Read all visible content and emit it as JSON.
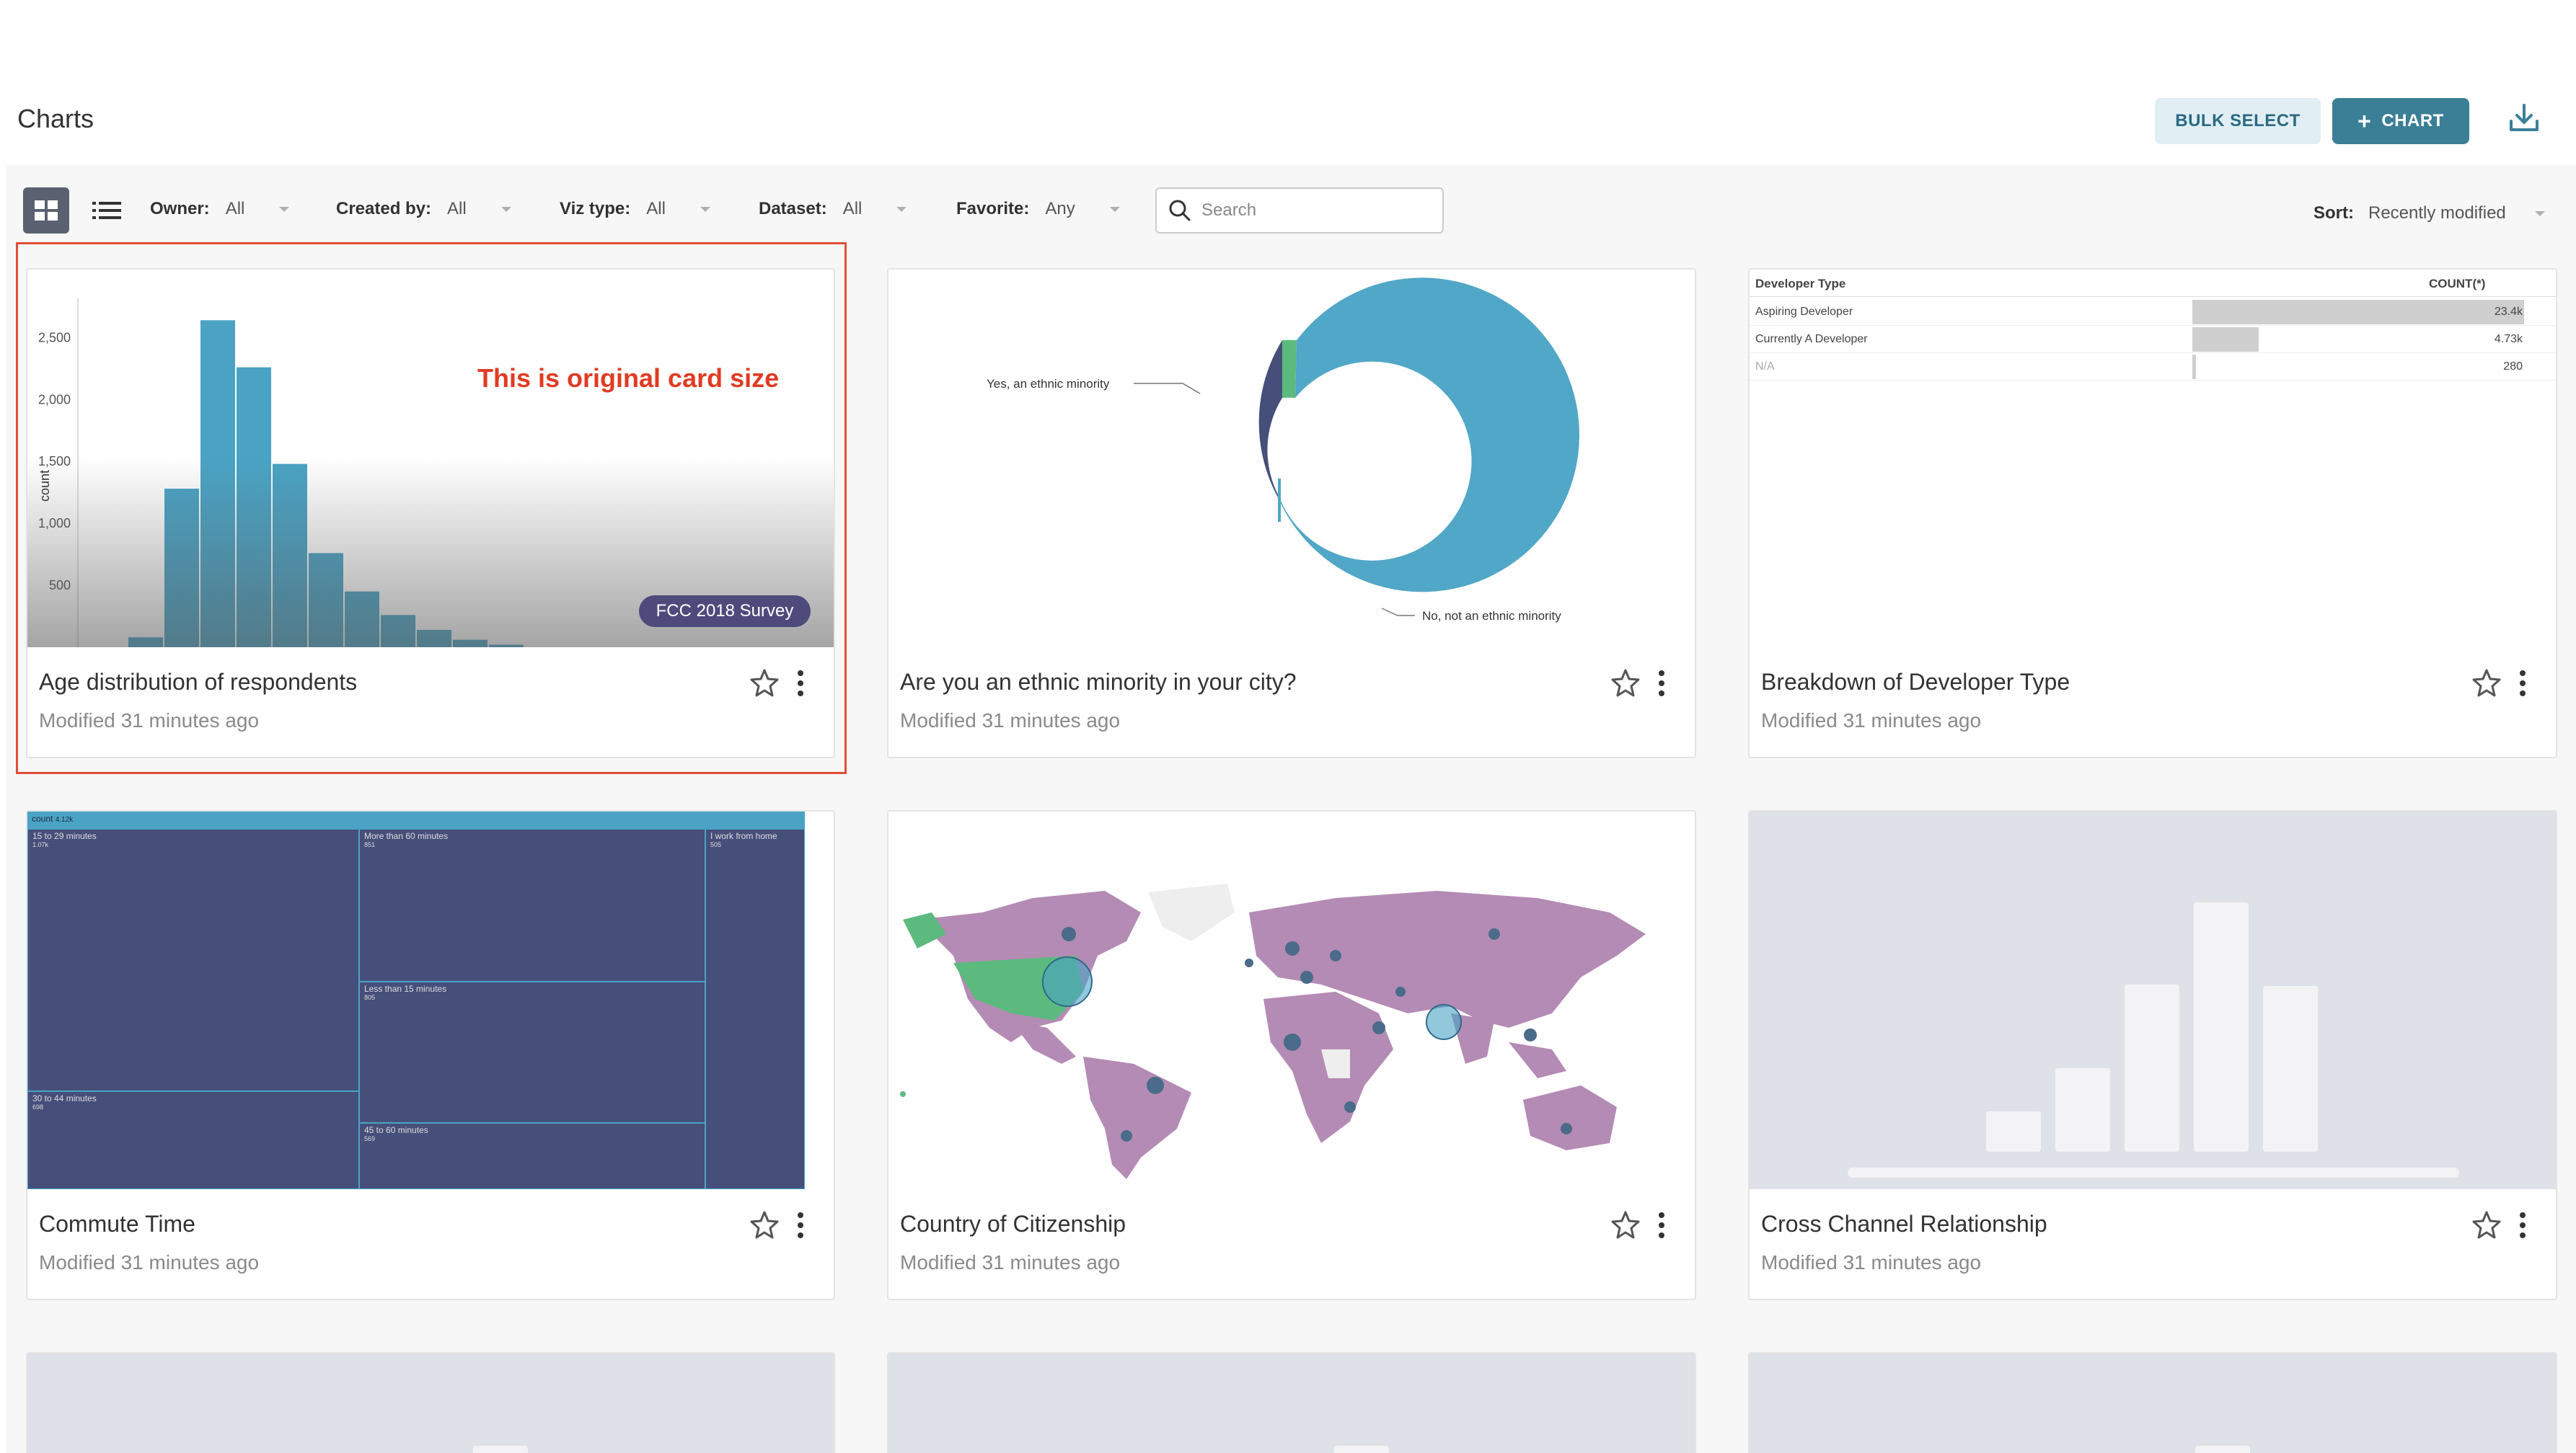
{
  "header": {
    "title": "Charts",
    "bulk_select": "BULK SELECT",
    "chart_button": "CHART",
    "chart_plus": "+"
  },
  "filters": {
    "owner": {
      "label": "Owner:",
      "value": "All"
    },
    "created_by": {
      "label": "Created by:",
      "value": "All"
    },
    "viz_type": {
      "label": "Viz type:",
      "value": "All"
    },
    "dataset": {
      "label": "Dataset:",
      "value": "All"
    },
    "favorite": {
      "label": "Favorite:",
      "value": "Any"
    },
    "search_placeholder": "Search",
    "sort": {
      "label": "Sort:",
      "value": "Recently modified"
    }
  },
  "annotation": "This is original card size",
  "cards": [
    {
      "title": "Age distribution of respondents",
      "modified": "Modified 31 minutes ago",
      "badge": "FCC 2018 Survey"
    },
    {
      "title": "Are you an ethnic minority in your city?",
      "modified": "Modified 31 minutes ago"
    },
    {
      "title": "Breakdown of Developer Type",
      "modified": "Modified 31 minutes ago"
    },
    {
      "title": "Commute Time",
      "modified": "Modified 31 minutes ago"
    },
    {
      "title": "Country of Citizenship",
      "modified": "Modified 31 minutes ago"
    },
    {
      "title": "Cross Channel Relationship",
      "modified": "Modified 31 minutes ago"
    }
  ],
  "histogram": {
    "ylabel": "count",
    "ticks": [
      "2,500",
      "2,000",
      "1,500",
      "1,000",
      "500"
    ],
    "values": [
      80,
      1280,
      2640,
      2260,
      1480,
      760,
      450,
      260,
      140,
      60,
      20
    ]
  },
  "donut": {
    "labels": [
      "Yes, an ethnic minority",
      "No, not an ethnic minority"
    ]
  },
  "dev_table": {
    "headers": [
      "Developer Type",
      "COUNT(*)"
    ],
    "rows": [
      {
        "label": "Aspiring Developer",
        "value": "23.4k",
        "fraction": 1.0
      },
      {
        "label": "Currently A Developer",
        "value": "4.73k",
        "fraction": 0.2
      },
      {
        "label": "N/A",
        "value": "280",
        "fraction": 0.01
      }
    ]
  },
  "treemap": {
    "header": "count",
    "header_value": "4.12k",
    "cells": [
      {
        "label": "15 to 29 minutes",
        "value": "1.07k"
      },
      {
        "label": "More than 60 minutes",
        "value": "851"
      },
      {
        "label": "I work from home",
        "value": "505"
      },
      {
        "label": "Less than 15 minutes",
        "value": "805"
      },
      {
        "label": "30 to 44 minutes",
        "value": "698"
      },
      {
        "label": "45 to 60 minutes",
        "value": "569"
      }
    ]
  },
  "colors": {
    "accent": "#3b7f96",
    "bar": "#4aa3c4",
    "donut_main": "#51a7c7",
    "donut_minor": "#464f7a",
    "donut_green": "#5dba7e",
    "treemap": "#464f7a",
    "map_land": "#b48bb4",
    "highlight": "#e04e36"
  }
}
